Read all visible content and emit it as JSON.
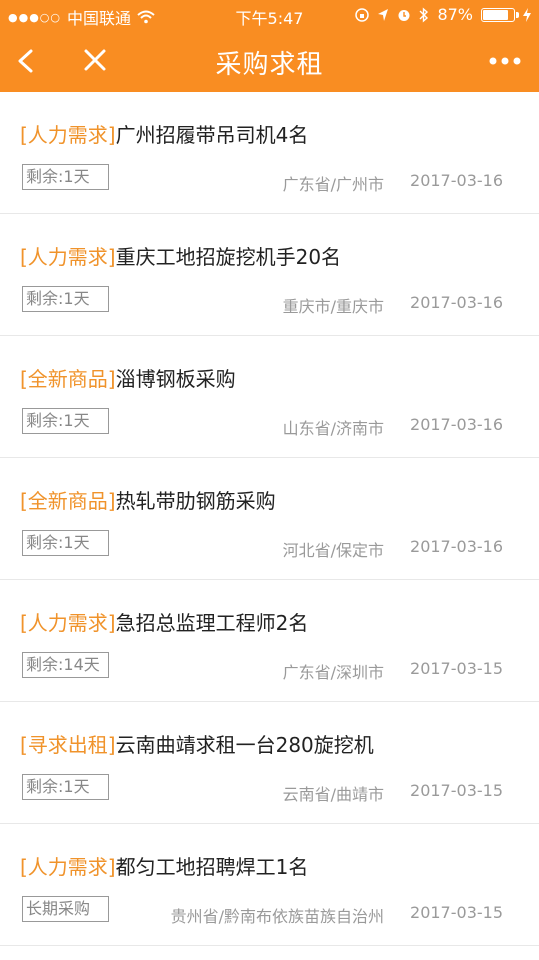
{
  "status": {
    "carrier": "中国联通",
    "time": "下午5:47",
    "battery": "87%",
    "battery_level": 0.87
  },
  "nav": {
    "title": "采购求租",
    "back_icon": "chevron-left-icon",
    "close_icon": "close-icon",
    "more_icon": "more-dots-icon",
    "color": "#f98d22"
  },
  "items": [
    {
      "category": "[人力需求]",
      "title": "广州招履带吊司机4名",
      "remaining": "剩余:1天",
      "location": "广东省/广州市",
      "date": "2017-03-16"
    },
    {
      "category": "[人力需求]",
      "title": "重庆工地招旋挖机手20名",
      "remaining": "剩余:1天",
      "location": "重庆市/重庆市",
      "date": "2017-03-16"
    },
    {
      "category": "[全新商品]",
      "title": "淄博钢板采购",
      "remaining": "剩余:1天",
      "location": "山东省/济南市",
      "date": "2017-03-16"
    },
    {
      "category": "[全新商品]",
      "title": "热轧带肋钢筋采购",
      "remaining": "剩余:1天",
      "location": "河北省/保定市",
      "date": "2017-03-16"
    },
    {
      "category": "[人力需求]",
      "title": "急招总监理工程师2名",
      "remaining": "剩余:14天",
      "location": "广东省/深圳市",
      "date": "2017-03-15"
    },
    {
      "category": "[寻求出租]",
      "title": "云南曲靖求租一台280旋挖机",
      "remaining": "剩余:1天",
      "location": "云南省/曲靖市",
      "date": "2017-03-15"
    },
    {
      "category": "[人力需求]",
      "title": "都匀工地招聘焊工1名",
      "remaining": "长期采购",
      "location": "贵州省/黔南布依族苗族自治州",
      "date": "2017-03-15"
    }
  ]
}
